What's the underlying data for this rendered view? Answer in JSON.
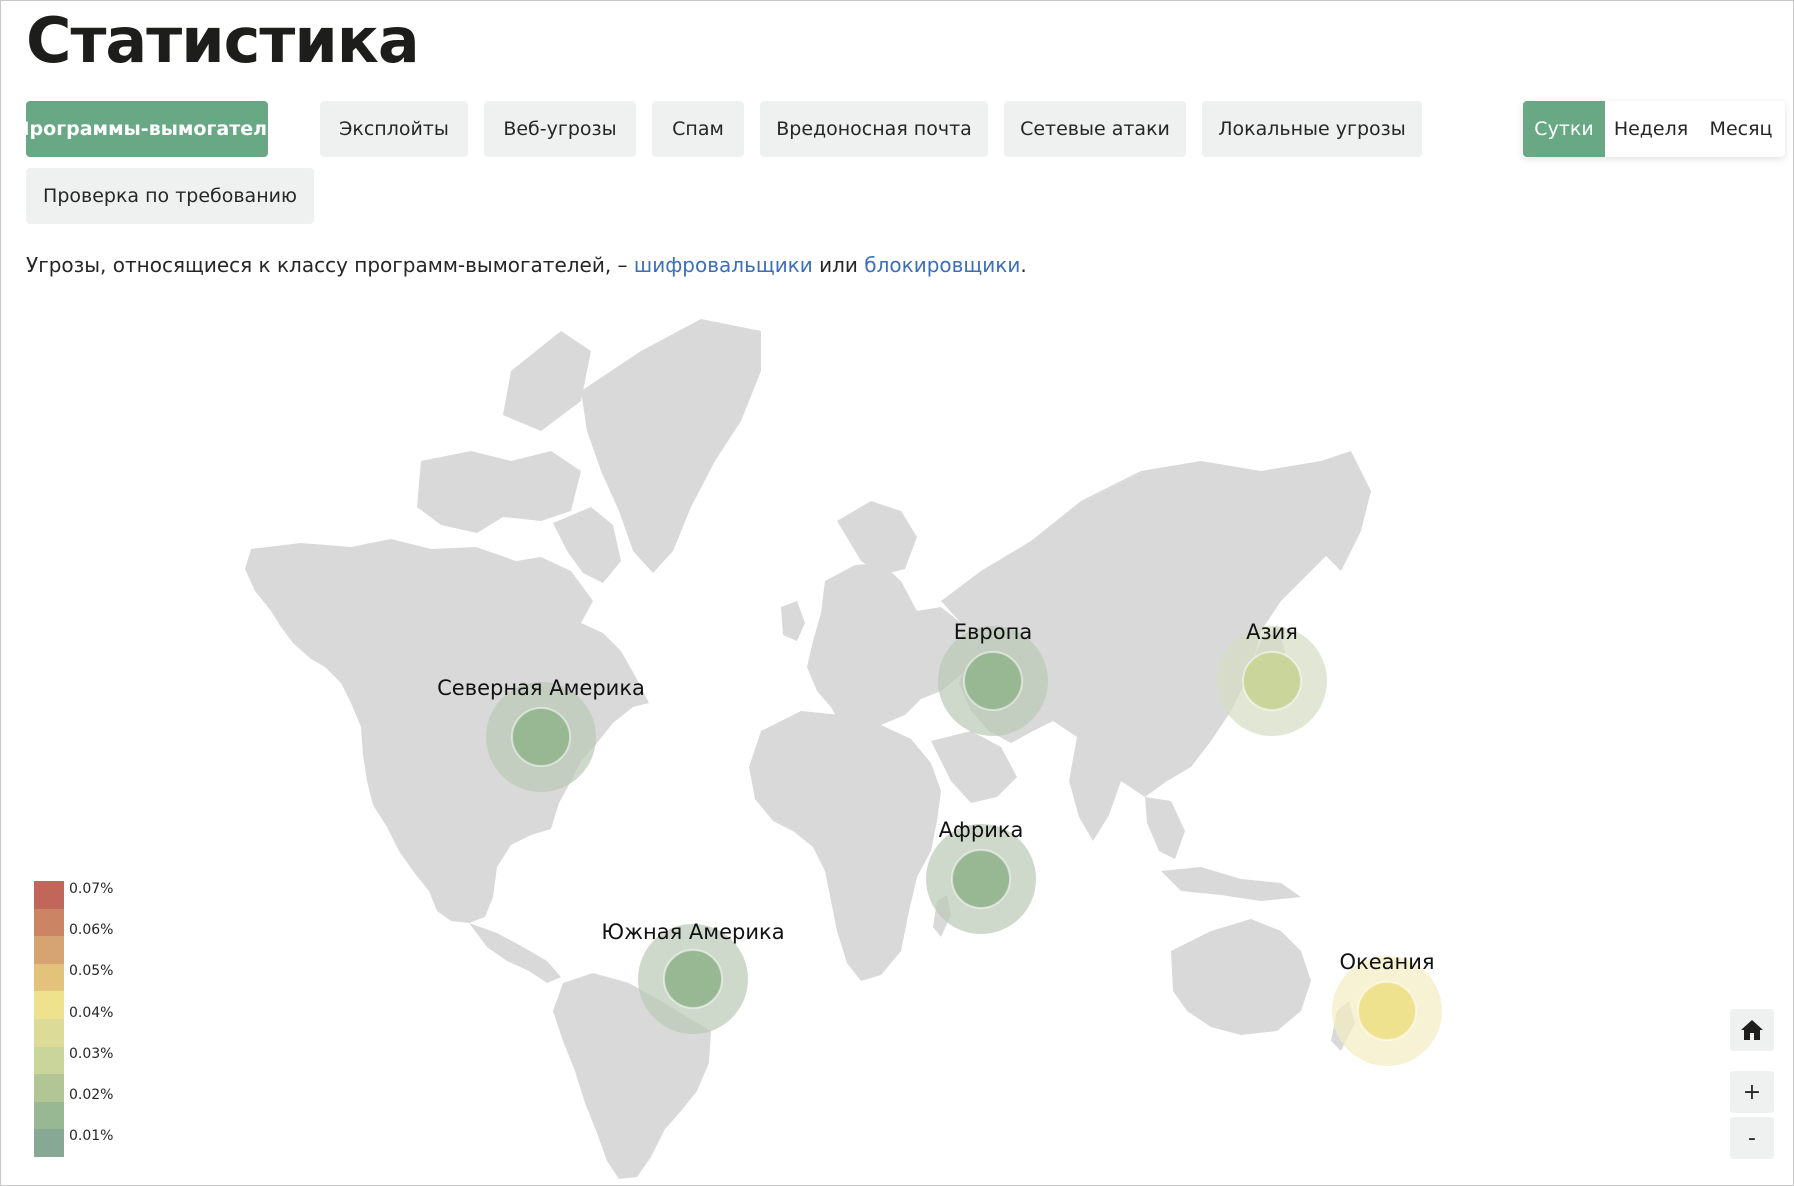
{
  "page": {
    "title": "Статистика",
    "description_prefix": "Угрозы, относящиеся к классу программ-вымогателей, – ",
    "link_1": "шифровальщики",
    "description_mid": " или ",
    "link_2": "блокировщики",
    "description_suffix": "."
  },
  "tabs": [
    {
      "label": "Программы-вымогатели",
      "active": true
    },
    {
      "label": "Эксплойты",
      "active": false
    },
    {
      "label": "Веб-угрозы",
      "active": false
    },
    {
      "label": "Спам",
      "active": false
    },
    {
      "label": "Вредоносная почта",
      "active": false
    },
    {
      "label": "Сетевые атаки",
      "active": false
    },
    {
      "label": "Локальные угрозы",
      "active": false
    },
    {
      "label": "Проверка по требованию",
      "active": false
    }
  ],
  "period": [
    {
      "label": "Сутки",
      "active": true
    },
    {
      "label": "Неделя",
      "active": false
    },
    {
      "label": "Месяц",
      "active": false
    }
  ],
  "regions": [
    {
      "label": "Северная Америка",
      "level": 1
    },
    {
      "label": "Европа",
      "level": 1
    },
    {
      "label": "Азия",
      "level": 2
    },
    {
      "label": "Африка",
      "level": 1
    },
    {
      "label": "Южная Америка",
      "level": 1
    },
    {
      "label": "Океания",
      "level": 4
    }
  ],
  "legend": {
    "labels": [
      "0.07%",
      "0.06%",
      "0.05%",
      "0.04%",
      "0.03%",
      "0.02%",
      "0.01%"
    ],
    "colors": [
      "#c0665a",
      "#cc8564",
      "#d5a472",
      "#e3c37c",
      "#efe28e",
      "#dcdb98",
      "#c9d59b",
      "#b1c694",
      "#98b894",
      "#86a894"
    ]
  },
  "controls": {
    "home_icon": "home-icon",
    "zoom_in": "+",
    "zoom_out": "-"
  },
  "colors": {
    "accent": "#68a884",
    "link": "#3d6eb8",
    "land": "#d9d9d9"
  }
}
